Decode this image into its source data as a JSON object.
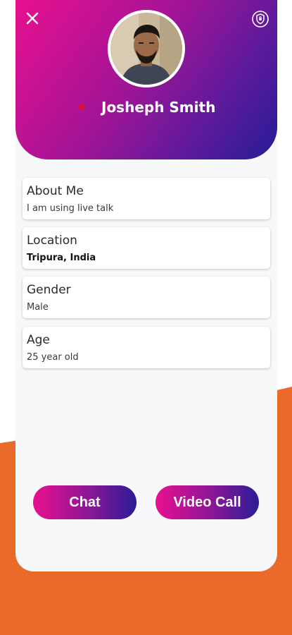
{
  "profile": {
    "name": "Josheph Smith",
    "online": true,
    "avatar_icon": "profile-photo"
  },
  "header": {
    "close_icon": "close-icon",
    "shield_icon": "shield-icon"
  },
  "info": [
    {
      "label": "About Me",
      "value": "I am using live talk"
    },
    {
      "label": "Location",
      "value": "Tripura, India"
    },
    {
      "label": "Gender",
      "value": "Male"
    },
    {
      "label": "Age",
      "value": "25 year old"
    }
  ],
  "actions": {
    "chat_label": "Chat",
    "video_call_label": "Video Call"
  },
  "colors": {
    "gradient_start": "#e8108f",
    "gradient_end": "#251c96",
    "background_wave": "#ea6a2c",
    "online_dot": "#e0102a"
  }
}
